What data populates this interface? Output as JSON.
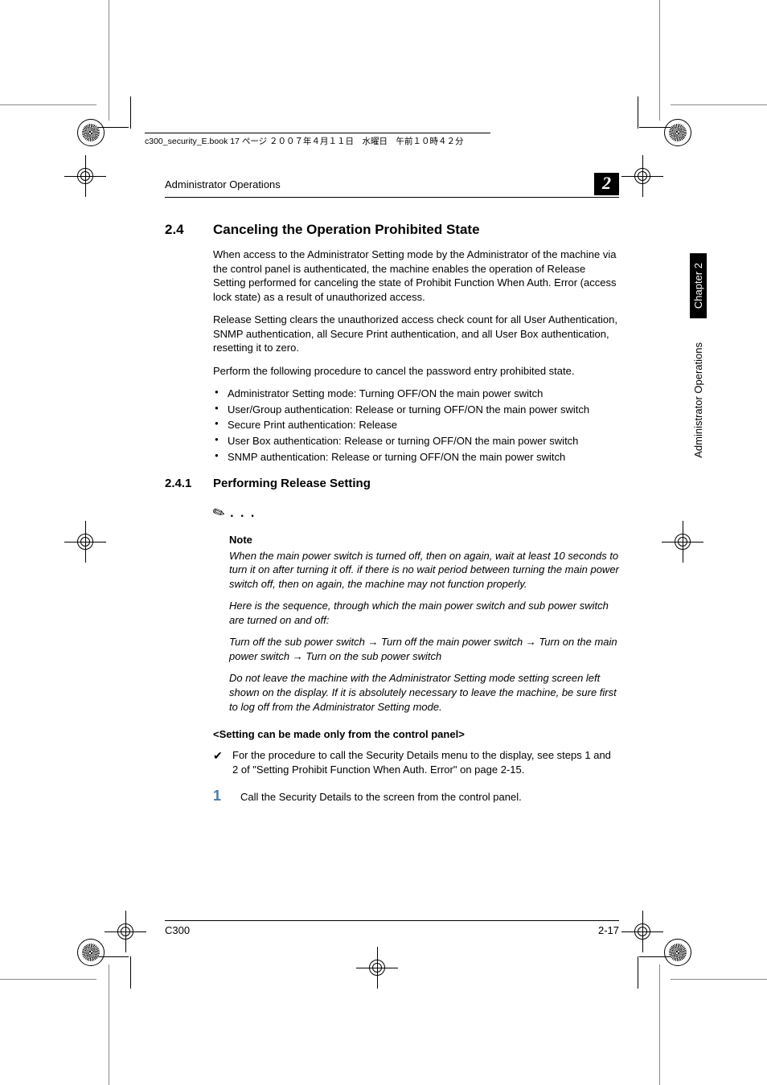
{
  "bookinfo": "c300_security_E.book  17 ページ  ２００７年４月１１日　水曜日　午前１０時４２分",
  "header": {
    "left": "Administrator Operations",
    "chapter_badge": "2"
  },
  "sidetab": {
    "chapter": "Chapter 2",
    "title": "Administrator Operations"
  },
  "section": {
    "num": "2.4",
    "title": "Canceling the Operation Prohibited State",
    "p1": "When access to the Administrator Setting mode by the Administrator of the machine via the control panel is authenticated, the machine enables the operation of Release Setting performed for canceling the state of Prohibit Function When Auth. Error (access lock state) as a result of unauthorized access.",
    "p2": "Release Setting clears the unauthorized access check count for all User Authentication, SNMP authentication, all Secure Print authentication, and all User Box authentication, resetting it to zero.",
    "p3": "Perform the following procedure to cancel the password entry prohibited state.",
    "bullets": [
      "Administrator Setting mode: Turning OFF/ON the main power switch",
      "User/Group authentication: Release or turning OFF/ON the main power switch",
      "Secure Print authentication: Release",
      "User Box authentication: Release or turning OFF/ON the main power switch",
      "SNMP authentication: Release or turning OFF/ON the main power switch"
    ]
  },
  "subsection": {
    "num": "2.4.1",
    "title": "Performing Release Setting",
    "note_heading": "Note",
    "note_p1": "When the main power switch is turned off, then on again, wait at least 10 seconds to turn it on after turning it off. if there is no wait period between turning the main power switch off, then on again, the machine may not function properly.",
    "note_p2": "Here is the sequence, through which the main power switch and sub power switch are turned on and off:",
    "note_p3": "Turn off the sub power switch → Turn off the main power switch → Turn on the main power switch → Turn on the sub power switch",
    "note_p4": "Do not leave the machine with the Administrator Setting mode setting screen left shown on the display. If it is absolutely necessary to leave the machine, be sure first to log off from the Administrator Setting mode.",
    "subheading": "<Setting can be made only from the control panel>",
    "check_text": "For the procedure to call the Security Details menu to the display, see steps 1 and 2 of \"Setting Prohibit Function When Auth. Error\" on page 2-15.",
    "step1_num": "1",
    "step1_text": "Call the Security Details to the screen from the control panel."
  },
  "footer": {
    "left": "C300",
    "right": "2-17"
  }
}
